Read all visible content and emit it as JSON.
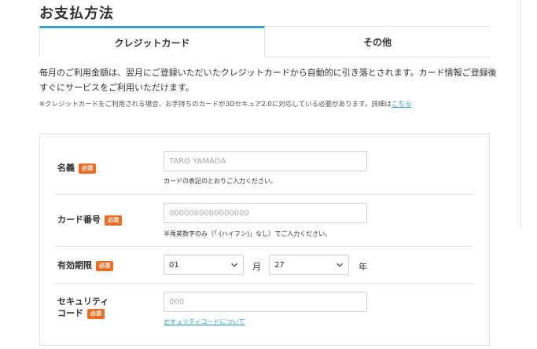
{
  "page": {
    "title": "お支払方法"
  },
  "tabs": [
    {
      "label": "クレジットカード",
      "active": true
    },
    {
      "label": "その他",
      "active": false
    }
  ],
  "description": {
    "line1": "毎月のご利用金額は、翌月にご登録いただいたクレジットカードから自動的に引き落とされます。カード情報ご登録後",
    "line2": "すぐにサービスをご利用いただけます。"
  },
  "note": {
    "text": "※クレジットカードをご利用される場合、お手持ちのカードが3Dセキュア2.0に対応している必要があります。詳細は",
    "link": "こちら"
  },
  "required_badge": "必須",
  "form": {
    "name": {
      "label": "名義",
      "placeholder": "TARO YAMADA",
      "hint": "カードの表記のとおりご入力ください。"
    },
    "card_number": {
      "label": "カード番号",
      "placeholder": "0000000000000000",
      "hint": "半角英数字のみ（「-(ハイフン)」なし）でご入力ください。"
    },
    "expiry": {
      "label": "有効期限",
      "month_value": "01",
      "month_unit": "月",
      "year_value": "27",
      "year_unit": "年"
    },
    "security_code": {
      "label_line1": "セキュリティ",
      "label_line2": "コード",
      "placeholder": "000",
      "link": "セキュリティコードについて"
    }
  },
  "colors": {
    "accent": "#3aa0c8",
    "badge": "#ec6d23",
    "link": "#2a9ac4"
  }
}
